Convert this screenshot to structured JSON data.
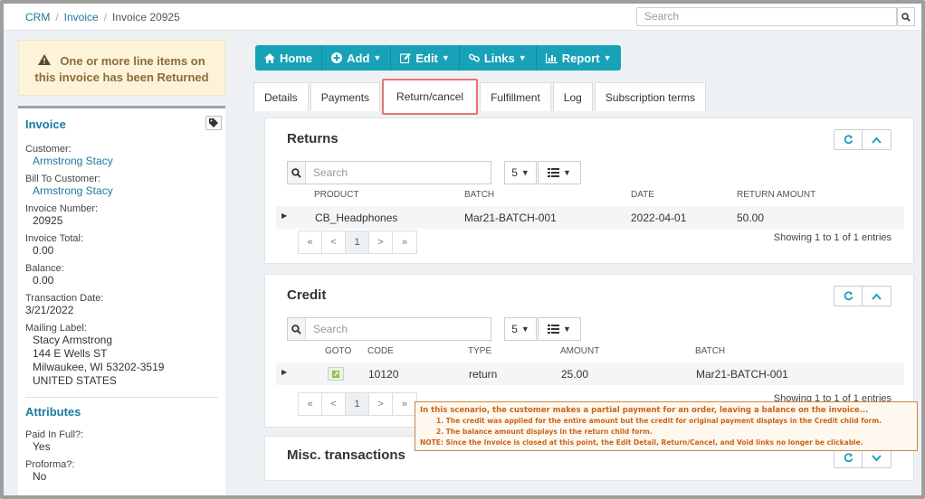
{
  "breadcrumb": {
    "crm": "CRM",
    "invoice": "Invoice",
    "current": "Invoice 20925"
  },
  "search_top": {
    "placeholder": "Search"
  },
  "alert": {
    "text": "One or more line items on this invoice has been Returned"
  },
  "left": {
    "invoice_title": "Invoice",
    "fields": [
      {
        "label": "Customer:",
        "value": "Armstrong Stacy"
      },
      {
        "label": "Bill To Customer:",
        "value": "Armstrong Stacy"
      },
      {
        "label": "Invoice Number:",
        "value": "20925"
      },
      {
        "label": "Invoice Total:",
        "value": "0.00"
      },
      {
        "label": "Balance:",
        "value": "0.00"
      },
      {
        "label": "Transaction Date:",
        "value": "3/21/2022"
      }
    ],
    "mailing_label": "Mailing Label:",
    "mailing_lines": [
      "Stacy Armstrong",
      "144 E Wells ST",
      "Milwaukee, WI 53202-3519",
      "UNITED STATES"
    ],
    "attributes_title": "Attributes",
    "attributes": [
      {
        "label": "Paid In Full?:",
        "value": "Yes"
      },
      {
        "label": "Proforma?:",
        "value": "No"
      }
    ]
  },
  "toolbar": {
    "home": "Home",
    "add": "Add",
    "edit": "Edit",
    "links": "Links",
    "report": "Report"
  },
  "tabs": [
    "Details",
    "Payments",
    "Return/cancel",
    "Fulfillment",
    "Log",
    "Subscription terms"
  ],
  "returns": {
    "title": "Returns",
    "search_placeholder": "Search",
    "page_size": "5",
    "columns": [
      "PRODUCT",
      "BATCH",
      "DATE",
      "RETURN AMOUNT"
    ],
    "row": {
      "product": "CB_Headphones",
      "batch": "Mar21-BATCH-001",
      "date": "2022-04-01",
      "amount": "50.00"
    },
    "pager": [
      "«",
      "<",
      "1",
      ">",
      "»"
    ],
    "showing": "Showing 1 to 1 of 1 entries"
  },
  "credit": {
    "title": "Credit",
    "search_placeholder": "Search",
    "page_size": "5",
    "columns": [
      "GOTO",
      "CODE",
      "TYPE",
      "AMOUNT",
      "BATCH"
    ],
    "row": {
      "code": "10120",
      "type": "return",
      "amount": "25.00",
      "batch": "Mar21-BATCH-001"
    },
    "pager": [
      "«",
      "<",
      "1",
      ">",
      "»"
    ],
    "showing": "Showing 1 to 1 of 1 entries"
  },
  "misc": {
    "title": "Misc. transactions"
  },
  "note": {
    "line1": "In this scenario, the customer makes a partial payment for an order, leaving a balance on the invoice...",
    "line2": "1. The credit was applied for the entire amount but the credit for original payment displays in the Credit child form.",
    "line3": "2. The balance amount displays in the return child form.",
    "line4": "NOTE: Since the Invoice is closed at this point, the Edit Detail, Return/Cancel, and Void links no longer be clickable."
  },
  "colors": {
    "accent": "#17a2b8",
    "link": "#1a7a9c",
    "highlight": "#e57373",
    "note": "#c8641a"
  }
}
